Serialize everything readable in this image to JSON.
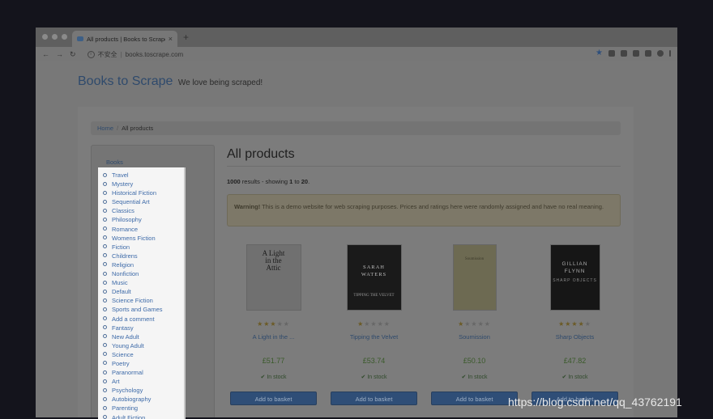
{
  "browser": {
    "tab_title": "All products | Books to Scrape",
    "tab_close": "×",
    "new_tab": "+",
    "nav": {
      "back": "←",
      "forward": "→",
      "reload": "↻"
    },
    "security_label": "不安全",
    "url_separator": "|",
    "url": "books.toscrape.com",
    "bookmark": "★"
  },
  "site": {
    "brand": "Books to Scrape",
    "tagline": "We love being scraped!"
  },
  "breadcrumb": {
    "home": "Home",
    "separator": "/",
    "current": "All products"
  },
  "sidebar": {
    "root": "Books"
  },
  "main": {
    "title": "All products",
    "results": {
      "count": "1000",
      "text_mid": " results - showing ",
      "from": "1",
      "to_word": " to ",
      "to": "20",
      "end": "."
    },
    "warning": {
      "label": "Warning!",
      "text": " This is a demo website for web scraping purposes. Prices and ratings here were randomly assigned and have no real meaning."
    }
  },
  "products": [
    {
      "title": "A Light in the ...",
      "price": "£51.77",
      "availability": "In stock",
      "rating": 3,
      "button": "Add to basket",
      "cover_lines": [
        "A Light",
        "in the",
        "Attic"
      ]
    },
    {
      "title": "Tipping the Velvet",
      "price": "£53.74",
      "availability": "In stock",
      "rating": 1,
      "button": "Add to basket",
      "cover_lines": [
        "SARAH",
        "WATERS",
        "TIPPING THE VELVET"
      ]
    },
    {
      "title": "Soumission",
      "price": "£50.10",
      "availability": "In stock",
      "rating": 1,
      "button": "Add to basket",
      "cover_lines": [
        "Soumission"
      ]
    },
    {
      "title": "Sharp Objects",
      "price": "£47.82",
      "availability": "In stock",
      "rating": 4,
      "button": "Add to basket",
      "cover_lines": [
        "GILLIAN",
        "FLYNN",
        "SHARP OBJECTS"
      ]
    }
  ],
  "categories": [
    "Travel",
    "Mystery",
    "Historical Fiction",
    "Sequential Art",
    "Classics",
    "Philosophy",
    "Romance",
    "Womens Fiction",
    "Fiction",
    "Childrens",
    "Religion",
    "Nonfiction",
    "Music",
    "Default",
    "Science Fiction",
    "Sports and Games",
    "Add a comment",
    "Fantasy",
    "New Adult",
    "Young Adult",
    "Science",
    "Poetry",
    "Paranormal",
    "Art",
    "Psychology",
    "Autobiography",
    "Parenting",
    "Adult Fiction"
  ],
  "watermark": "https://blog.csdn.net/qq_43762191",
  "colors": {
    "link": "#3d6aa8",
    "button": "#2f4e77",
    "price": "#3a5a2a",
    "overlay": "#787878"
  }
}
